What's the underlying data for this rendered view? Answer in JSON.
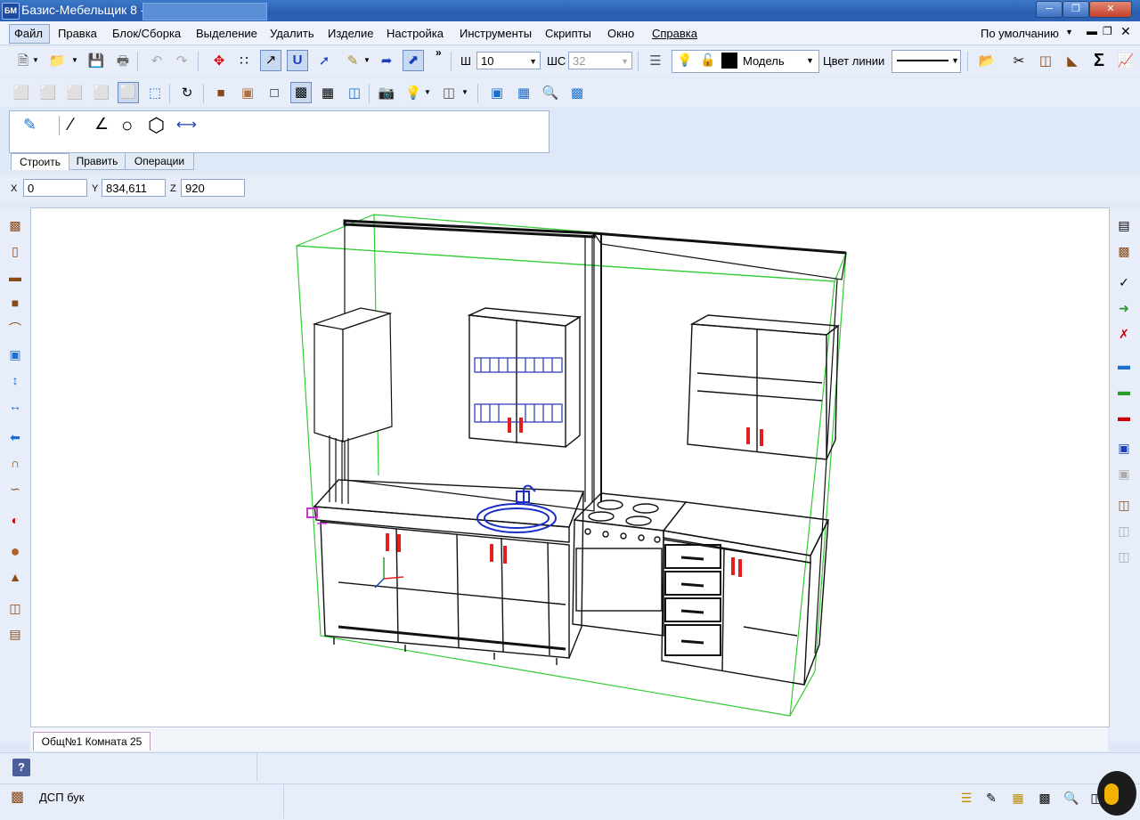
{
  "window": {
    "title": "Базис-Мебельщик 8 -"
  },
  "menu": {
    "items": [
      "Файл",
      "Правка",
      "Блок/Сборка",
      "Выделение",
      "Удалить",
      "Изделие",
      "Настройка",
      "Инструменты",
      "Скрипты",
      "Окно",
      "Справка"
    ],
    "profile": "По умолчанию"
  },
  "toolbar": {
    "w_label": "Ш",
    "w_value": "10",
    "ws_label": "ШС",
    "ws_value": "32",
    "layer_value": "Модель",
    "line_color_label": "Цвет линии"
  },
  "panel": {
    "tabs": [
      "Строить",
      "Править",
      "Операции"
    ]
  },
  "coords": {
    "x_label": "X",
    "x_value": "0",
    "y_label": "Y",
    "y_value": "834,611",
    "z_label": "Z",
    "z_value": "920"
  },
  "document": {
    "tab": "Общ№1 Комната 25"
  },
  "status": {
    "material": "ДСП бук",
    "help_icon": "?"
  },
  "colors": {
    "accent": "#2a5fb0",
    "selection_box": "#33cc33",
    "handles": "#e02020",
    "sink": "#1a2ec8",
    "gizmo": "#cc33cc"
  }
}
